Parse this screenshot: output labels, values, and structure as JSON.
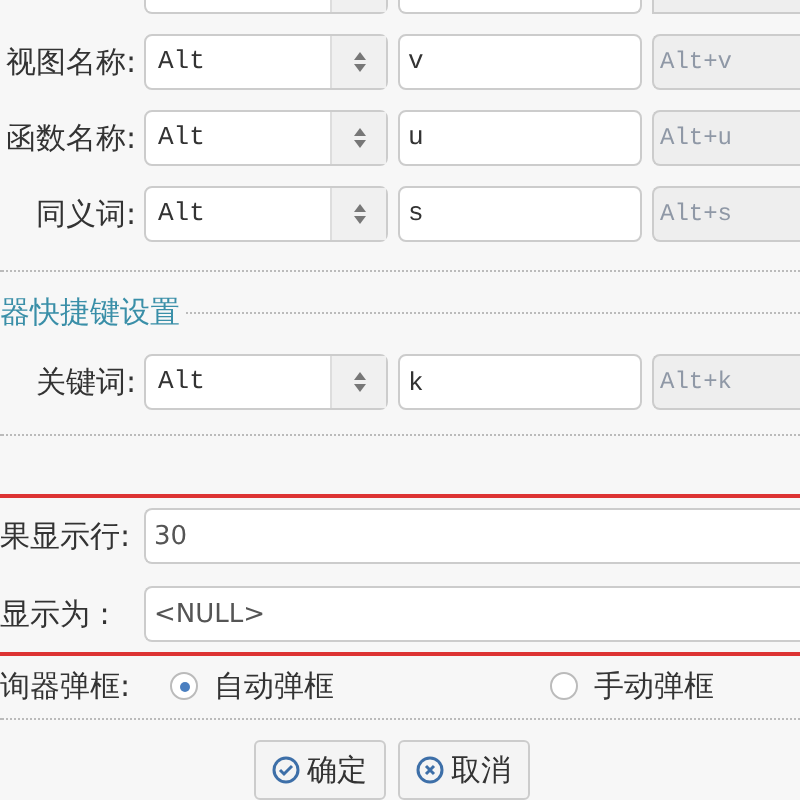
{
  "shortcut_rows": [
    {
      "label": "视图名称:",
      "modifier": "Alt",
      "key": "v",
      "preview": "Alt+v"
    },
    {
      "label": "函数名称:",
      "modifier": "Alt",
      "key": "u",
      "preview": "Alt+u"
    },
    {
      "label": "同义词:",
      "modifier": "Alt",
      "key": "s",
      "preview": "Alt+s"
    }
  ],
  "section": {
    "title": "器快捷键设置",
    "rows": [
      {
        "label": "关键词:",
        "modifier": "Alt",
        "key": "k",
        "preview": "Alt+k"
      }
    ]
  },
  "highlighted_fields": [
    {
      "label": "果显示行:",
      "value": "30"
    },
    {
      "label": "显示为 :",
      "value": "<NULL>"
    }
  ],
  "popup_setting": {
    "label": "询器弹框:",
    "options": [
      {
        "label": "自动弹框",
        "selected": true
      },
      {
        "label": "手动弹框",
        "selected": false
      }
    ]
  },
  "buttons": [
    {
      "kind": "confirm",
      "label": "确定"
    },
    {
      "kind": "cancel",
      "label": "取消"
    }
  ]
}
